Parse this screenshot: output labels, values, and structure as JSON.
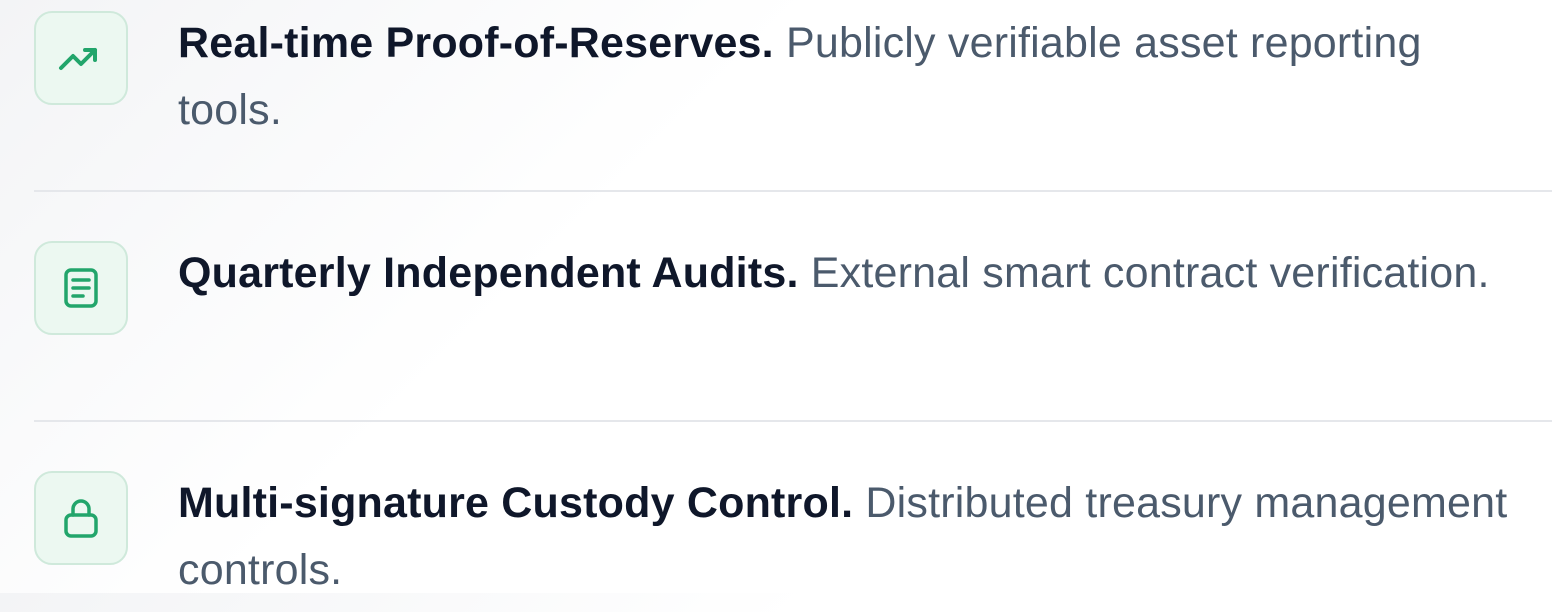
{
  "features": [
    {
      "title": "Real-time Proof-of-Reserves.",
      "description": "Publicly verifiable asset reporting tools.",
      "icon": "trending-up-icon"
    },
    {
      "title": "Quarterly Independent Audits.",
      "description": "External smart contract verification.",
      "icon": "document-icon"
    },
    {
      "title": "Multi-signature Custody Control.",
      "description": "Distributed treasury management controls.",
      "icon": "lock-icon"
    }
  ],
  "colors": {
    "accent": "#22a56b",
    "icon_bg": "#ecf8f1",
    "icon_border": "#cfe9db",
    "title": "#0f172a",
    "description": "#4b5a6c",
    "divider": "#e5e7eb"
  }
}
